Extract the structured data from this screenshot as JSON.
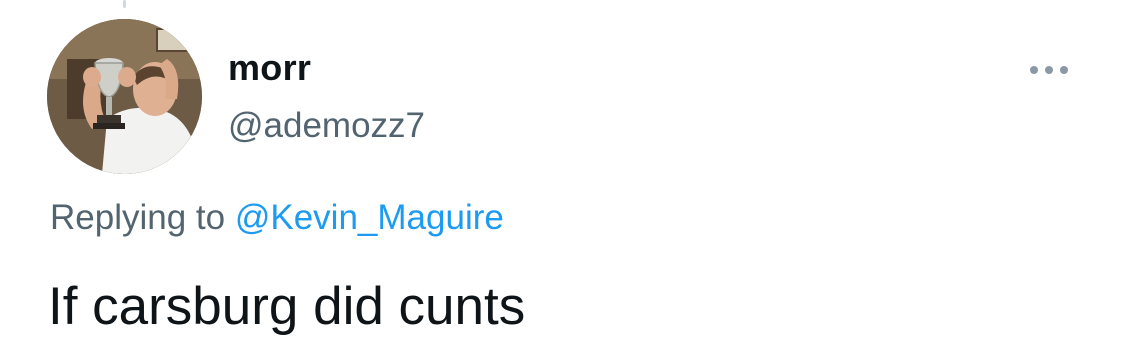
{
  "tweet": {
    "author": {
      "display_name": "morr",
      "handle": "@ademozz7"
    },
    "replying_prefix": "Replying to",
    "replying_to": "@Kevin_Maguire",
    "text": "If carsburg did cunts",
    "more_icon": "more-horizontal-icon"
  },
  "colors": {
    "primary_text": "#0f1419",
    "secondary_text": "#536471",
    "link": "#1d9bf0",
    "more_dots": "#8b98a5"
  }
}
